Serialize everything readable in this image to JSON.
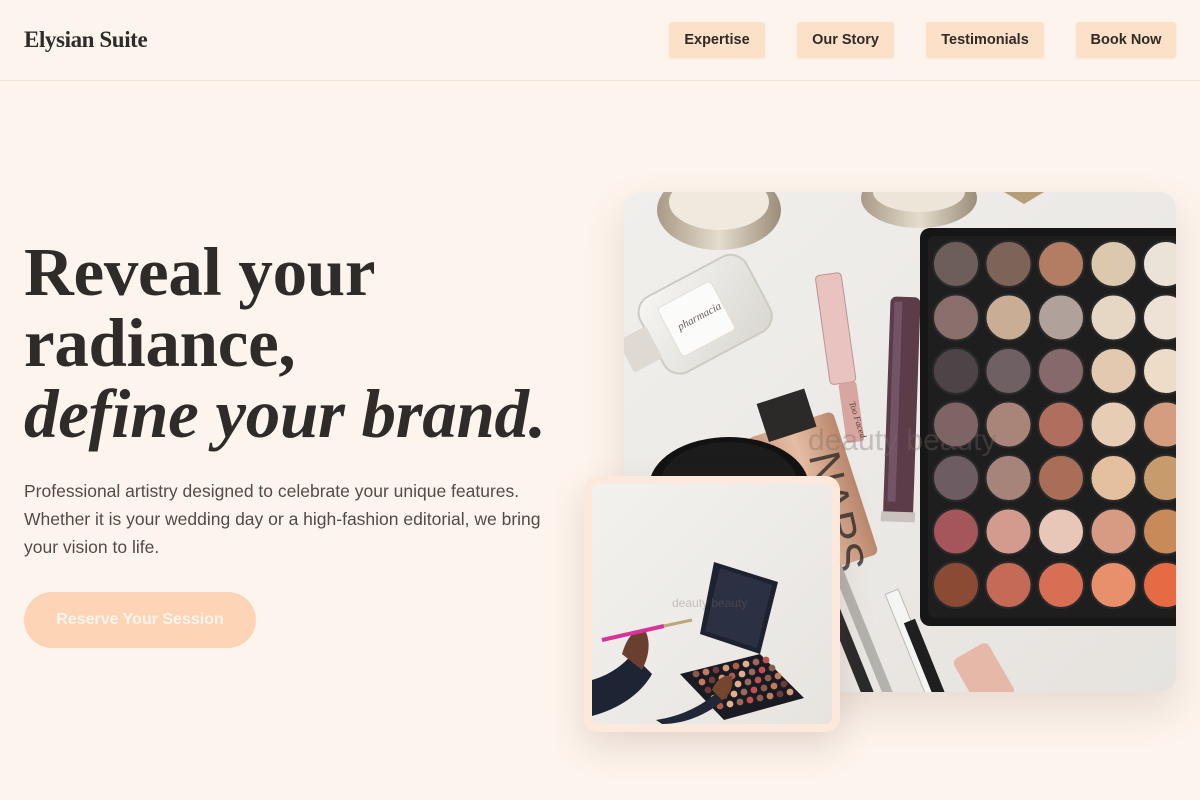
{
  "header": {
    "logo": "Elysian Suite",
    "nav": [
      {
        "label": "Expertise"
      },
      {
        "label": "Our Story"
      },
      {
        "label": "Testimonials"
      },
      {
        "label": "Book Now"
      }
    ]
  },
  "hero": {
    "headline_line1": "Reveal your",
    "headline_line2": "radiance,",
    "headline_line3": "define your brand.",
    "description": "Professional artistry designed to celebrate your unique features. Whether it is your wedding day or a high-fashion editorial, we bring your vision to life.",
    "cta_label": "Reserve Your Session"
  },
  "images": {
    "main_watermark": "deauty beauty",
    "small_watermark": "deauty beauty"
  },
  "colors": {
    "background": "#fdf4ed",
    "button": "#fde0c8",
    "cta": "#fdd5b6",
    "text": "#2e2b29"
  }
}
